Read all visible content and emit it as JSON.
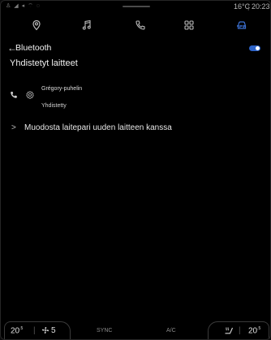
{
  "status_bar": {
    "temperature": "16°C",
    "separator": "|",
    "time": "20:23",
    "icons": [
      "user-icon",
      "signal-icon",
      "location-icon",
      "wifi-icon",
      "notification-icon"
    ]
  },
  "top_nav": {
    "items": [
      {
        "name": "navigation",
        "icon": "location-pin-icon"
      },
      {
        "name": "music",
        "icon": "music-note-icon"
      },
      {
        "name": "phone",
        "icon": "phone-icon"
      },
      {
        "name": "apps",
        "icon": "apps-grid-icon"
      },
      {
        "name": "vehicle",
        "icon": "car-icon",
        "active": true
      }
    ],
    "active_color": "#3b6fd0"
  },
  "header": {
    "back_glyph": "←",
    "title": "Bluetooth",
    "bluetooth_enabled": true
  },
  "section_title": "Yhdistetyt laitteet",
  "device": {
    "name": "Grégory-puhelin",
    "status": "Yhdistetty"
  },
  "pair_new": {
    "chevron": ">",
    "label": "Muodosta laitepari uuden laitteen kanssa"
  },
  "climate_bar": {
    "temp_left": "20",
    "temp_left_suffix": ".5",
    "divider": "|",
    "fan_level": "5",
    "sync_label": "SYNC",
    "ac_label": "A/C",
    "temp_right": "20",
    "temp_right_suffix": ".5"
  }
}
